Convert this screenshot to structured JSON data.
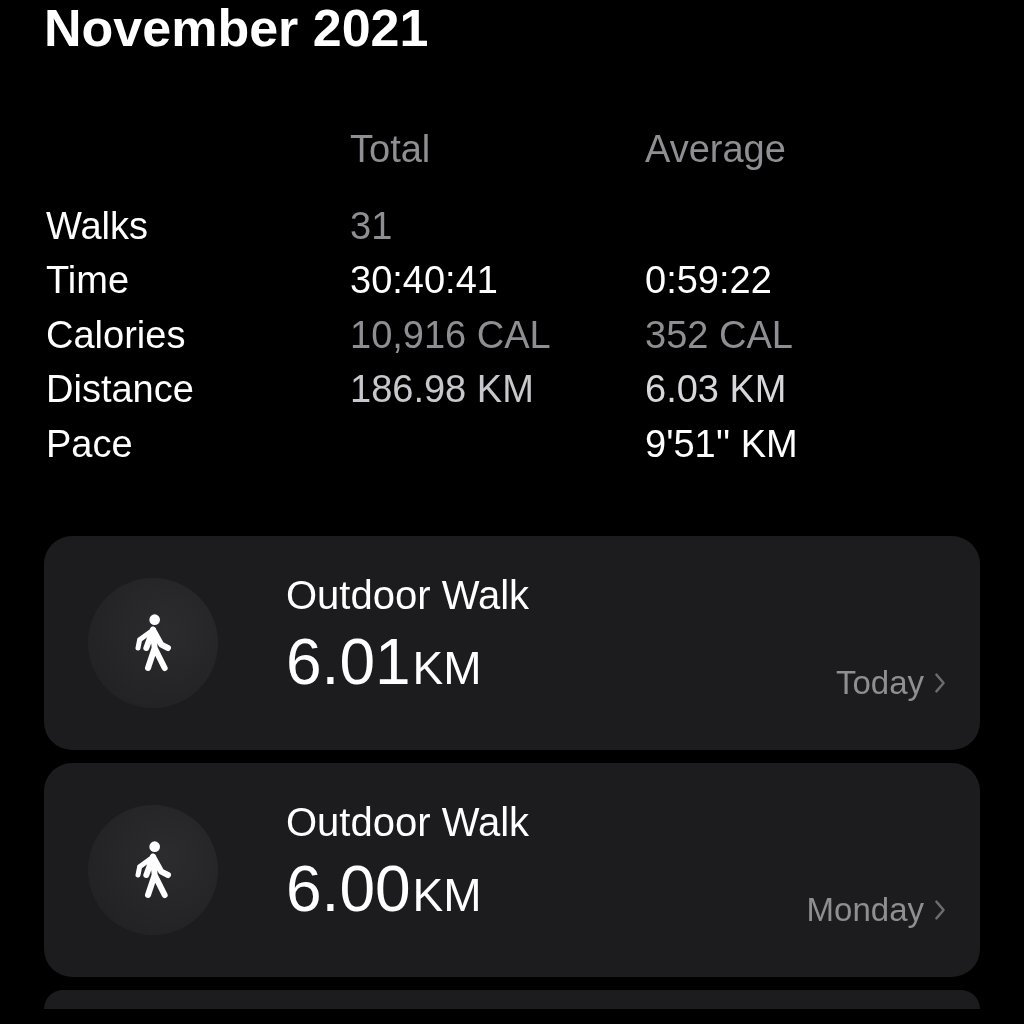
{
  "title": "November 2021",
  "summary": {
    "columns": [
      "Total",
      "Average"
    ],
    "rows": [
      {
        "label": "Walks",
        "total": {
          "text": "31",
          "color": "#8e8e93"
        }
      },
      {
        "label": "Time",
        "total": {
          "text": "30:40:41",
          "color": "#ffffff"
        },
        "average": {
          "text": "0:59:22",
          "color": "#ffffff"
        }
      },
      {
        "label": "Calories",
        "total": {
          "text": "10,916 CAL",
          "color": "#8e8e93"
        },
        "average": {
          "text": "352 CAL",
          "color": "#8e8e93"
        }
      },
      {
        "label": "Distance",
        "total": {
          "text": "186.98 KM",
          "color": "#c7c7cc"
        },
        "average": {
          "text": "6.03 KM",
          "color": "#d8d8dc"
        }
      },
      {
        "label": "Pace",
        "average": {
          "text": "9'51'' KM",
          "color": "#ffffff"
        }
      }
    ]
  },
  "workouts": [
    {
      "kind": "walk",
      "name": "Outdoor Walk",
      "value": "6.01",
      "unit": "KM",
      "date": "Today"
    },
    {
      "kind": "walk",
      "name": "Outdoor Walk",
      "value": "6.00",
      "unit": "KM",
      "date": "Monday"
    },
    {
      "kind": "clipped"
    }
  ]
}
